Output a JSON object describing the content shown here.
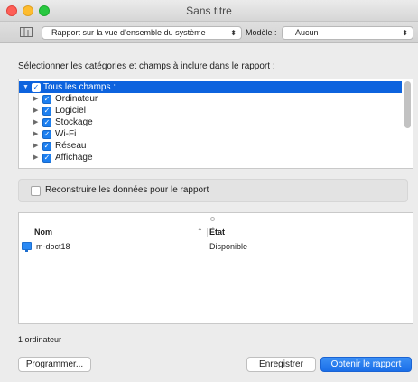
{
  "window": {
    "title": "Sans titre"
  },
  "toolbar": {
    "report_popup": "Rapport sur la vue d’ensemble du système",
    "model_label": "Modèle :",
    "model_popup": "Aucun"
  },
  "instructions": "Sélectionner les catégories et champs à inclure dans le rapport :",
  "tree": {
    "items": [
      {
        "label": "Tous les champs :",
        "checked": true,
        "expanded": true,
        "selected": true
      },
      {
        "label": "Ordinateur",
        "checked": true
      },
      {
        "label": "Logiciel",
        "checked": true
      },
      {
        "label": "Stockage",
        "checked": true
      },
      {
        "label": "Wi-Fi",
        "checked": true
      },
      {
        "label": "Réseau",
        "checked": true
      },
      {
        "label": "Affichage",
        "checked": true
      }
    ]
  },
  "rebuild": {
    "label": "Reconstruire les données pour le rapport",
    "checked": false
  },
  "table": {
    "columns": {
      "name": "Nom",
      "state": "État"
    },
    "rows": [
      {
        "name": "m-doct18",
        "state": "Disponible"
      }
    ]
  },
  "footer": {
    "count": "1 ordinateur",
    "schedule_label": "Programmer...",
    "save_label": "Enregistrer",
    "get_report_label": "Obtenir le rapport"
  },
  "colors": {
    "accent": "#1c7ff0",
    "selection": "#0d63de"
  },
  "icons": {
    "toolbar": "columns-icon",
    "tree_disclosure": "triangle-icon",
    "row": "monitor-icon"
  }
}
